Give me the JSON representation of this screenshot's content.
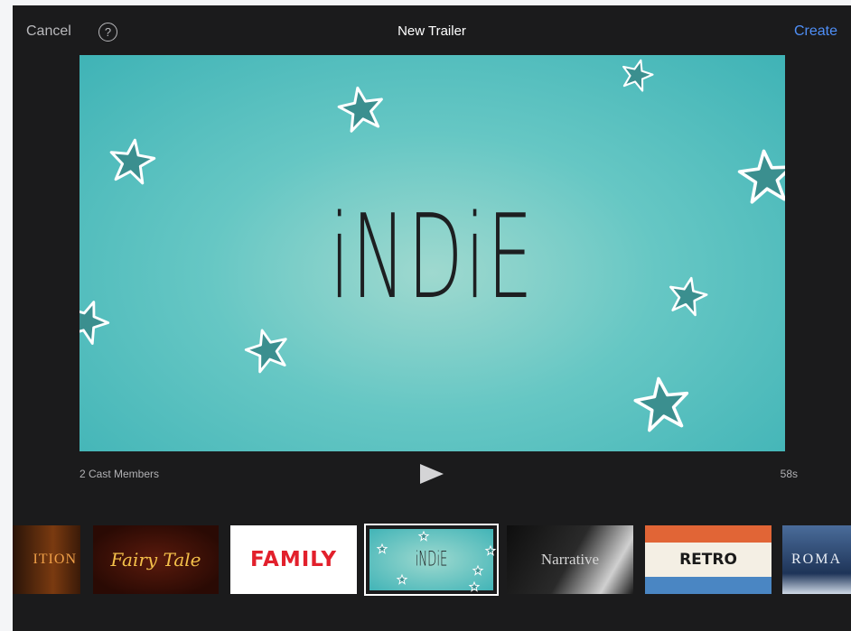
{
  "header": {
    "cancel_label": "Cancel",
    "help_label": "?",
    "title": "New Trailer",
    "create_label": "Create"
  },
  "preview": {
    "title_text": "iNDiE"
  },
  "info": {
    "cast_members": "2 Cast Members",
    "duration": "58s"
  },
  "templates": [
    {
      "label": "ITION"
    },
    {
      "label": "Fairy Tale"
    },
    {
      "label": "FAMILY"
    },
    {
      "label": "iNDiE",
      "selected": true
    },
    {
      "label": "Narrative"
    },
    {
      "label": "RETRO"
    },
    {
      "label": "ROMA"
    }
  ],
  "colors": {
    "accent": "#4f8ff7",
    "background": "#1b1b1c",
    "teal": "#41b4b7"
  }
}
